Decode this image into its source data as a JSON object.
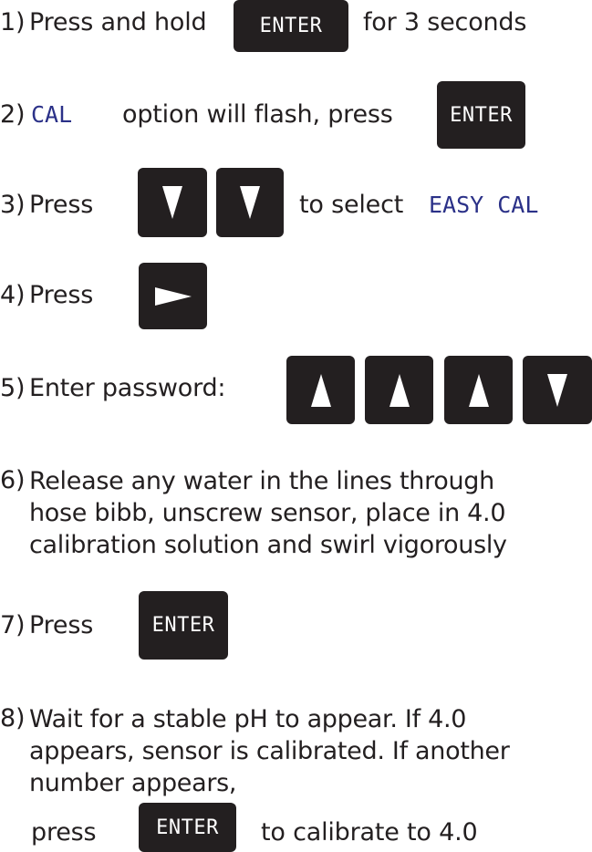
{
  "colors": {
    "key_bg": "#231f20",
    "key_text": "#ffffff",
    "lcd_text": "#2b3188",
    "body_text": "#231f20"
  },
  "keys": {
    "enter": "ENTER"
  },
  "icons": {
    "down": "down-triangle-icon",
    "up": "up-triangle-icon",
    "right": "right-triangle-icon"
  },
  "steps": {
    "s1": {
      "num": "1)",
      "before": "Press and hold",
      "after": "for 3 seconds"
    },
    "s2": {
      "num": "2)",
      "lcd": "CAL",
      "after": "option will flash, press"
    },
    "s3": {
      "num": "3)",
      "before": "Press",
      "after": "to select",
      "lcd": "EASY CAL"
    },
    "s4": {
      "num": "4)",
      "before": "Press"
    },
    "s5": {
      "num": "5)",
      "before": "Enter password:"
    },
    "s6": {
      "num": "6)",
      "lines": [
        "Release any water in the lines through",
        "hose bibb, unscrew sensor, place in 4.0",
        "calibration solution and swirl vigorously"
      ]
    },
    "s7": {
      "num": "7)",
      "before": "Press"
    },
    "s8": {
      "num": "8)",
      "lines": [
        "Wait for a stable pH to appear.  If 4.0",
        "appears, sensor is calibrated.  If another",
        "number appears,"
      ],
      "press": "press",
      "after": "to calibrate to 4.0"
    }
  }
}
